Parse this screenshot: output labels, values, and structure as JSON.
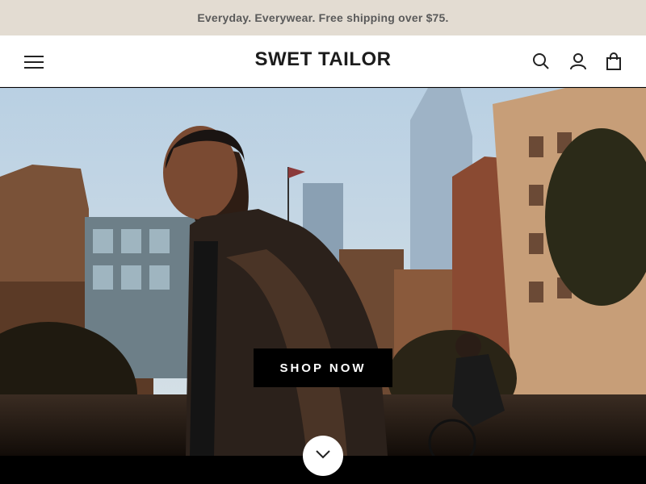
{
  "announcement": {
    "text": "Everyday. Everywear. Free shipping over $75."
  },
  "header": {
    "logo": "SWET TAILOR",
    "icons": [
      "menu-icon",
      "search-icon",
      "account-icon",
      "cart-icon"
    ]
  },
  "hero": {
    "cta_label": "SHOP NOW",
    "scroll_icon": "chevron-down-icon"
  },
  "colors": {
    "announcement_bg": "#e3dcd2",
    "announcement_text": "#5a5a5a",
    "header_bg": "#ffffff",
    "cta_bg": "#000000",
    "cta_text": "#ffffff"
  }
}
